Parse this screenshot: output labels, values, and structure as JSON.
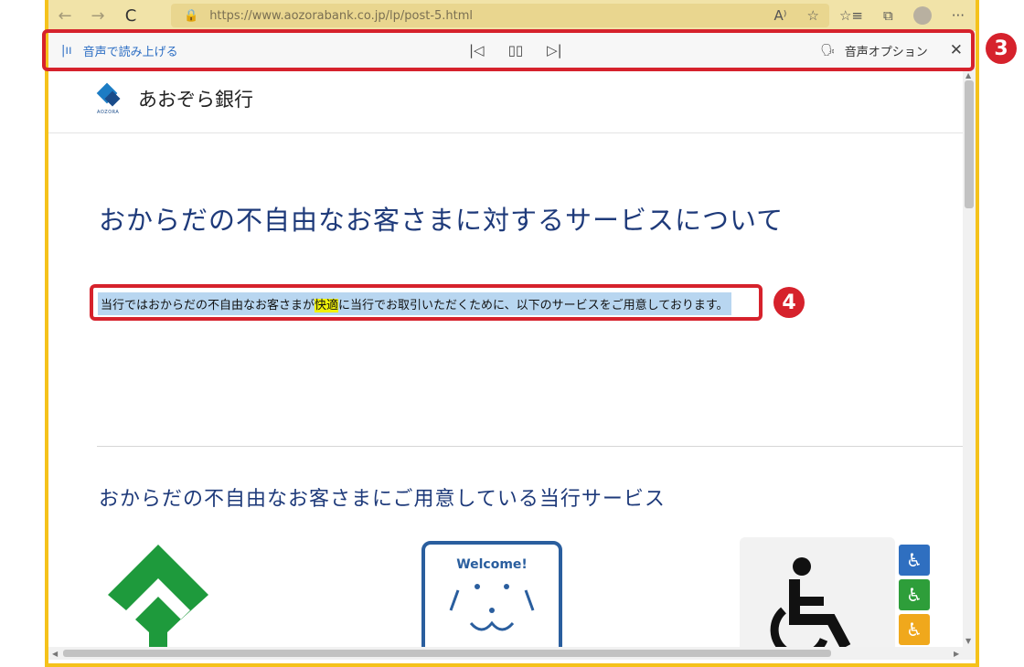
{
  "browser": {
    "url": "https://www.aozorabank.co.jp/lp/post-5.html",
    "back_icon": "←",
    "forward_icon": "→",
    "refresh_icon": "C",
    "lock_icon": "🔒",
    "read_aloud_icon": "A⁾",
    "favorite_icon": "☆",
    "favorites_icon": "☆≡",
    "collections_icon": "⧉",
    "more_icon": "···"
  },
  "read_aloud": {
    "label": "音声で読み上げる",
    "waveform_icon": "|ıı",
    "prev_icon": "|◁",
    "pause_icon": "▯▯",
    "next_icon": "▷|",
    "options_icon": "🗣",
    "options_label": "音声オプション",
    "close_icon": "✕"
  },
  "page": {
    "logo_text": "あおぞら銀行",
    "logo_sub": "AOZORA",
    "heading": "おからだの不自由なお客さまに対するサービスについて",
    "intro_before": "当行ではおからだの不自由なお客さまが",
    "intro_highlight": "快適",
    "intro_after": "に当行でお取引いただくために、以下のサービスをご用意しております。",
    "subheading": "おからだの不自由なお客さまにご用意している当行サービス",
    "welcome_text": "Welcome!"
  },
  "annotations": {
    "badge_3": "3",
    "badge_4": "4"
  },
  "colors": {
    "accent": "#f5c21b",
    "highlight": "#f0f20a",
    "selection": "#b8d6f0",
    "callout": "#d6222c",
    "heading": "#1e3a7a"
  }
}
